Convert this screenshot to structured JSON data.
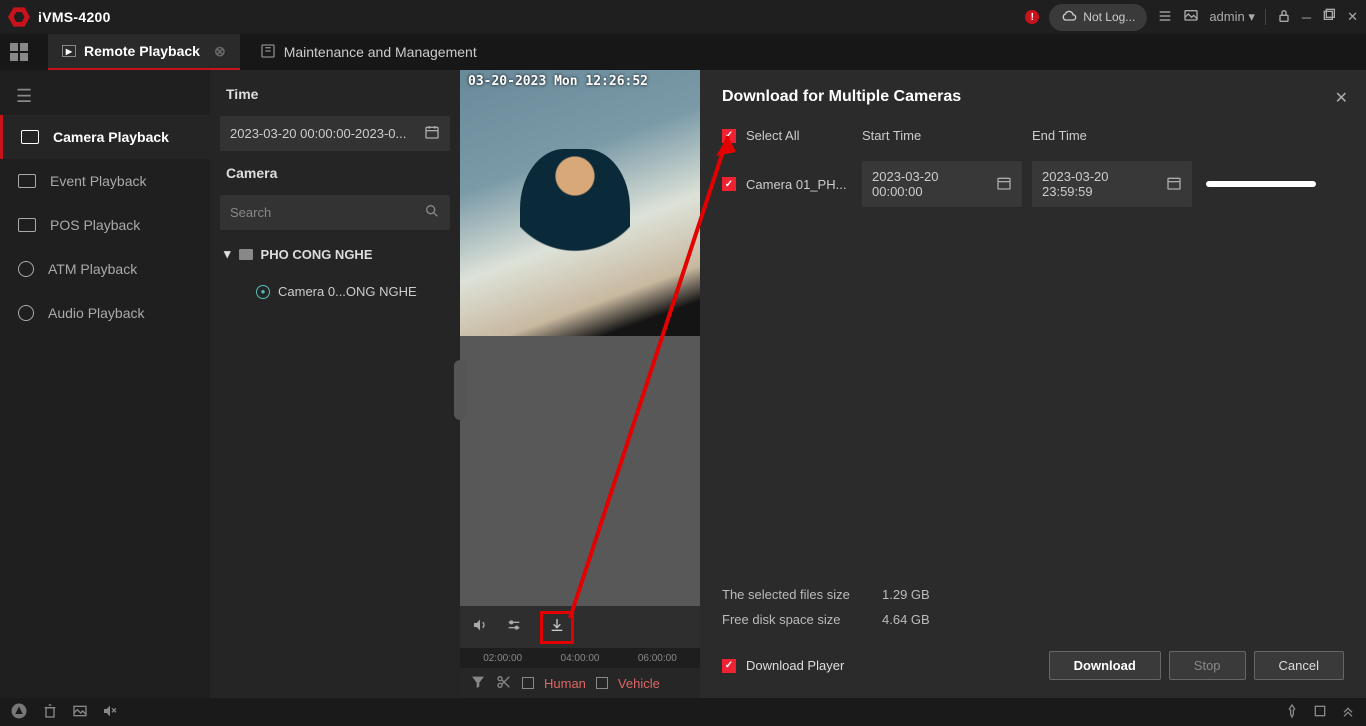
{
  "app": {
    "title": "iVMS-4200"
  },
  "titlebar": {
    "not_logged": "Not Log...",
    "user": "admin"
  },
  "tabs": {
    "active": "Remote Playback",
    "other": "Maintenance and Management"
  },
  "sidebar": {
    "items": [
      {
        "label": "Camera Playback",
        "active": true
      },
      {
        "label": "Event Playback",
        "active": false
      },
      {
        "label": "POS Playback",
        "active": false
      },
      {
        "label": "ATM Playback",
        "active": false
      },
      {
        "label": "Audio Playback",
        "active": false
      }
    ]
  },
  "tree": {
    "time_label": "Time",
    "time_value": "2023-03-20 00:00:00-2023-0...",
    "camera_label": "Camera",
    "search_placeholder": "Search",
    "folder": "PHO CONG NGHE",
    "camera_item": "Camera 0...ONG NGHE"
  },
  "video": {
    "osd": "03-20-2023 Mon 12:26:52",
    "timeline": [
      "02:00:00",
      "04:00:00",
      "06:00:00"
    ],
    "filter_human": "Human",
    "filter_vehicle": "Vehicle"
  },
  "download": {
    "title": "Download for Multiple Cameras",
    "select_all": "Select All",
    "start_time_label": "Start Time",
    "end_time_label": "End Time",
    "row": {
      "camera": "Camera 01_PH...",
      "start": "2023-03-20 00:00:00",
      "end": "2023-03-20 23:59:59"
    },
    "selected_size_label": "The selected files size",
    "selected_size_value": "1.29 GB",
    "free_disk_label": "Free disk space size",
    "free_disk_value": "4.64 GB",
    "download_player": "Download Player",
    "btn_download": "Download",
    "btn_stop": "Stop",
    "btn_cancel": "Cancel"
  }
}
